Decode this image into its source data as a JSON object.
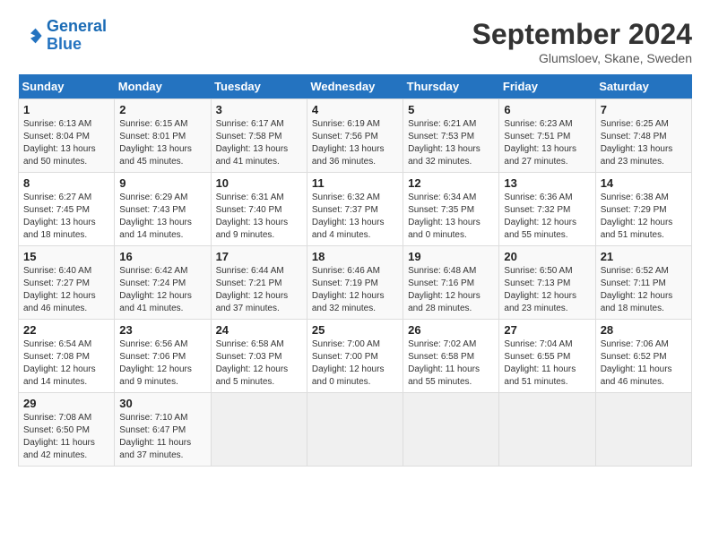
{
  "header": {
    "logo_line1": "General",
    "logo_line2": "Blue",
    "month": "September 2024",
    "location": "Glumsloev, Skane, Sweden"
  },
  "days_of_week": [
    "Sunday",
    "Monday",
    "Tuesday",
    "Wednesday",
    "Thursday",
    "Friday",
    "Saturday"
  ],
  "weeks": [
    [
      {
        "day": "1",
        "info": "Sunrise: 6:13 AM\nSunset: 8:04 PM\nDaylight: 13 hours\nand 50 minutes."
      },
      {
        "day": "2",
        "info": "Sunrise: 6:15 AM\nSunset: 8:01 PM\nDaylight: 13 hours\nand 45 minutes."
      },
      {
        "day": "3",
        "info": "Sunrise: 6:17 AM\nSunset: 7:58 PM\nDaylight: 13 hours\nand 41 minutes."
      },
      {
        "day": "4",
        "info": "Sunrise: 6:19 AM\nSunset: 7:56 PM\nDaylight: 13 hours\nand 36 minutes."
      },
      {
        "day": "5",
        "info": "Sunrise: 6:21 AM\nSunset: 7:53 PM\nDaylight: 13 hours\nand 32 minutes."
      },
      {
        "day": "6",
        "info": "Sunrise: 6:23 AM\nSunset: 7:51 PM\nDaylight: 13 hours\nand 27 minutes."
      },
      {
        "day": "7",
        "info": "Sunrise: 6:25 AM\nSunset: 7:48 PM\nDaylight: 13 hours\nand 23 minutes."
      }
    ],
    [
      {
        "day": "8",
        "info": "Sunrise: 6:27 AM\nSunset: 7:45 PM\nDaylight: 13 hours\nand 18 minutes."
      },
      {
        "day": "9",
        "info": "Sunrise: 6:29 AM\nSunset: 7:43 PM\nDaylight: 13 hours\nand 14 minutes."
      },
      {
        "day": "10",
        "info": "Sunrise: 6:31 AM\nSunset: 7:40 PM\nDaylight: 13 hours\nand 9 minutes."
      },
      {
        "day": "11",
        "info": "Sunrise: 6:32 AM\nSunset: 7:37 PM\nDaylight: 13 hours\nand 4 minutes."
      },
      {
        "day": "12",
        "info": "Sunrise: 6:34 AM\nSunset: 7:35 PM\nDaylight: 13 hours\nand 0 minutes."
      },
      {
        "day": "13",
        "info": "Sunrise: 6:36 AM\nSunset: 7:32 PM\nDaylight: 12 hours\nand 55 minutes."
      },
      {
        "day": "14",
        "info": "Sunrise: 6:38 AM\nSunset: 7:29 PM\nDaylight: 12 hours\nand 51 minutes."
      }
    ],
    [
      {
        "day": "15",
        "info": "Sunrise: 6:40 AM\nSunset: 7:27 PM\nDaylight: 12 hours\nand 46 minutes."
      },
      {
        "day": "16",
        "info": "Sunrise: 6:42 AM\nSunset: 7:24 PM\nDaylight: 12 hours\nand 41 minutes."
      },
      {
        "day": "17",
        "info": "Sunrise: 6:44 AM\nSunset: 7:21 PM\nDaylight: 12 hours\nand 37 minutes."
      },
      {
        "day": "18",
        "info": "Sunrise: 6:46 AM\nSunset: 7:19 PM\nDaylight: 12 hours\nand 32 minutes."
      },
      {
        "day": "19",
        "info": "Sunrise: 6:48 AM\nSunset: 7:16 PM\nDaylight: 12 hours\nand 28 minutes."
      },
      {
        "day": "20",
        "info": "Sunrise: 6:50 AM\nSunset: 7:13 PM\nDaylight: 12 hours\nand 23 minutes."
      },
      {
        "day": "21",
        "info": "Sunrise: 6:52 AM\nSunset: 7:11 PM\nDaylight: 12 hours\nand 18 minutes."
      }
    ],
    [
      {
        "day": "22",
        "info": "Sunrise: 6:54 AM\nSunset: 7:08 PM\nDaylight: 12 hours\nand 14 minutes."
      },
      {
        "day": "23",
        "info": "Sunrise: 6:56 AM\nSunset: 7:06 PM\nDaylight: 12 hours\nand 9 minutes."
      },
      {
        "day": "24",
        "info": "Sunrise: 6:58 AM\nSunset: 7:03 PM\nDaylight: 12 hours\nand 5 minutes."
      },
      {
        "day": "25",
        "info": "Sunrise: 7:00 AM\nSunset: 7:00 PM\nDaylight: 12 hours\nand 0 minutes."
      },
      {
        "day": "26",
        "info": "Sunrise: 7:02 AM\nSunset: 6:58 PM\nDaylight: 11 hours\nand 55 minutes."
      },
      {
        "day": "27",
        "info": "Sunrise: 7:04 AM\nSunset: 6:55 PM\nDaylight: 11 hours\nand 51 minutes."
      },
      {
        "day": "28",
        "info": "Sunrise: 7:06 AM\nSunset: 6:52 PM\nDaylight: 11 hours\nand 46 minutes."
      }
    ],
    [
      {
        "day": "29",
        "info": "Sunrise: 7:08 AM\nSunset: 6:50 PM\nDaylight: 11 hours\nand 42 minutes."
      },
      {
        "day": "30",
        "info": "Sunrise: 7:10 AM\nSunset: 6:47 PM\nDaylight: 11 hours\nand 37 minutes."
      },
      {
        "day": "",
        "info": ""
      },
      {
        "day": "",
        "info": ""
      },
      {
        "day": "",
        "info": ""
      },
      {
        "day": "",
        "info": ""
      },
      {
        "day": "",
        "info": ""
      }
    ]
  ]
}
